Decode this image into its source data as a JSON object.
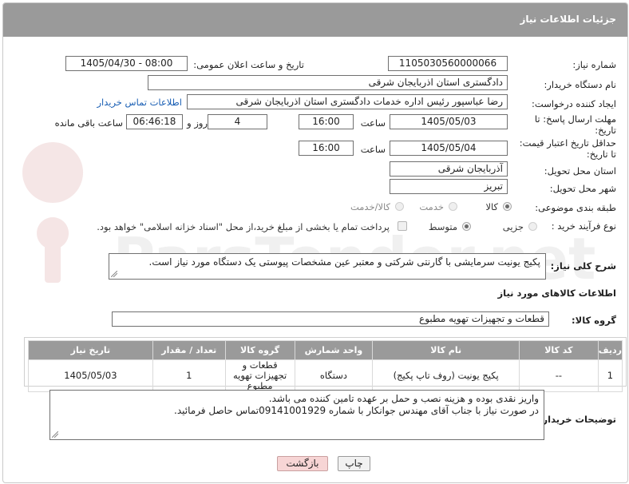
{
  "header": {
    "title": "جزئیات اطلاعات نیاز"
  },
  "fields": {
    "need_number": {
      "label": "شماره نیاز:",
      "value": "1105030560000066"
    },
    "announce_datetime": {
      "label": "تاریخ و ساعت اعلان عمومی:",
      "value": "1405/04/30 - 08:00"
    },
    "buyer_org": {
      "label": "نام دستگاه خریدار:",
      "value": "دادگستری استان اذربایجان شرقی"
    },
    "requester": {
      "label": "ایجاد کننده درخواست:",
      "value": "رضا عباسپور رئیس اداره خدمات دادگستری استان اذربایجان شرقی",
      "contact_link": "اطلاعات تماس خریدار"
    },
    "reply_deadline": {
      "label_line1": "مهلت ارسال پاسخ: تا",
      "label_line2": "تاریخ:",
      "date": "1405/05/03",
      "time_label": "ساعت",
      "time": "16:00",
      "days": "4",
      "days_label": "روز و",
      "remaining": "06:46:18",
      "remaining_label": "ساعت باقی مانده"
    },
    "price_validity": {
      "label_line1": "حداقل تاریخ اعتبار قیمت:",
      "label_line2": "تا تاریخ:",
      "date": "1405/05/04",
      "time_label": "ساعت",
      "time": "16:00"
    },
    "delivery_province": {
      "label": "استان محل تحویل:",
      "value": "آذربایجان شرقی"
    },
    "delivery_city": {
      "label": "شهر محل تحویل:",
      "value": "تبریز"
    },
    "category": {
      "label": "طبقه بندی موضوعی:",
      "options": [
        "کالا",
        "خدمت",
        "کالا/خدمت"
      ],
      "selected": "کالا"
    },
    "purchase_process": {
      "label": "نوع فرآیند خرید :",
      "options": [
        "جزیی",
        "متوسط"
      ],
      "selected": "متوسط",
      "treasury_note": "پرداخت تمام یا بخشی از مبلغ خرید،از محل \"اسناد خزانه اسلامی\" خواهد بود."
    }
  },
  "description": {
    "label": "شرح کلی نیاز:",
    "value": "پکیج یونیت سرمایشی با گارنتی شرکتی و معتبر عین مشخصات پیوستی یک دستگاه مورد نیاز است."
  },
  "goods_section": {
    "title": "اطلاعات کالاهای مورد نیاز",
    "group_label": "گروه کالا:",
    "group_value": "قطعات و تجهیزات تهویه مطبوع"
  },
  "items_table": {
    "columns": [
      "ردیف",
      "کد کالا",
      "نام کالا",
      "واحد شمارش",
      "گروه کالا",
      "تعداد / مقدار",
      "تاریخ نیاز"
    ],
    "rows": [
      [
        "1",
        "--",
        "پکیج یونیت (روف تاپ پکیج)",
        "دستگاه",
        "قطعات و تجهیزات تهویه مطبوع",
        "1",
        "1405/05/03"
      ]
    ]
  },
  "buyer_notes": {
    "label": "توضیحات خریدار:",
    "line1": "واریز نقدی بوده و هزینه نصب و حمل بر عهده تامین کننده می باشد.",
    "line2": "در صورت نیاز با جناب آقای مهندس جوانکار با شماره 09141001929تماس حاصل فرمائید."
  },
  "buttons": {
    "print": "چاپ",
    "back": "بازگشت"
  },
  "colors": {
    "header_bg": "#9a9a9a",
    "link": "#1a5fb4",
    "back_button": "#f7d5d5"
  }
}
